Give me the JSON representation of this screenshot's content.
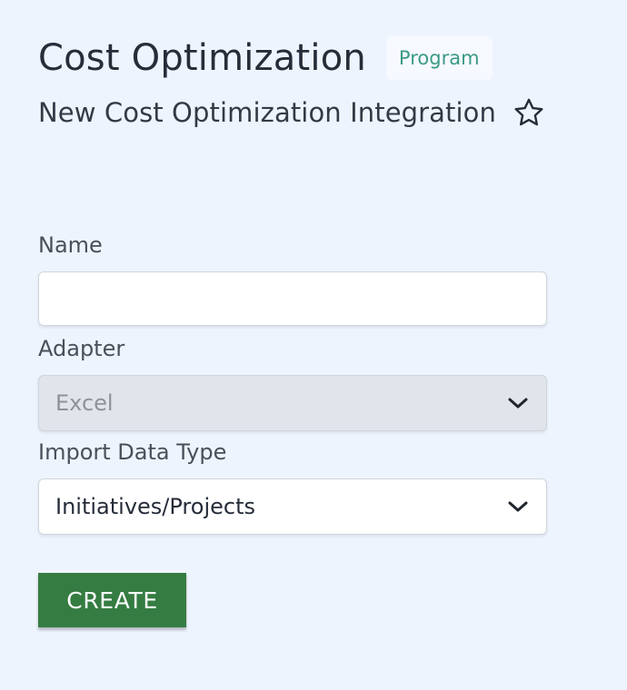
{
  "header": {
    "title": "Cost Optimization",
    "badge": "Program",
    "subtitle": "New Cost Optimization Integration"
  },
  "form": {
    "name": {
      "label": "Name",
      "value": "",
      "placeholder": ""
    },
    "adapter": {
      "label": "Adapter",
      "value": "Excel",
      "disabled": true
    },
    "import_data_type": {
      "label": "Import Data Type",
      "value": "Initiatives/Projects"
    },
    "create_label": "CREATE"
  },
  "icons": {
    "favorite": "star-outline-icon",
    "dropdown": "chevron-down-icon"
  },
  "colors": {
    "background": "#eef4fe",
    "badge_text": "#3b9a86",
    "primary_button": "#357c42",
    "disabled_select": "#e1e4ea"
  }
}
